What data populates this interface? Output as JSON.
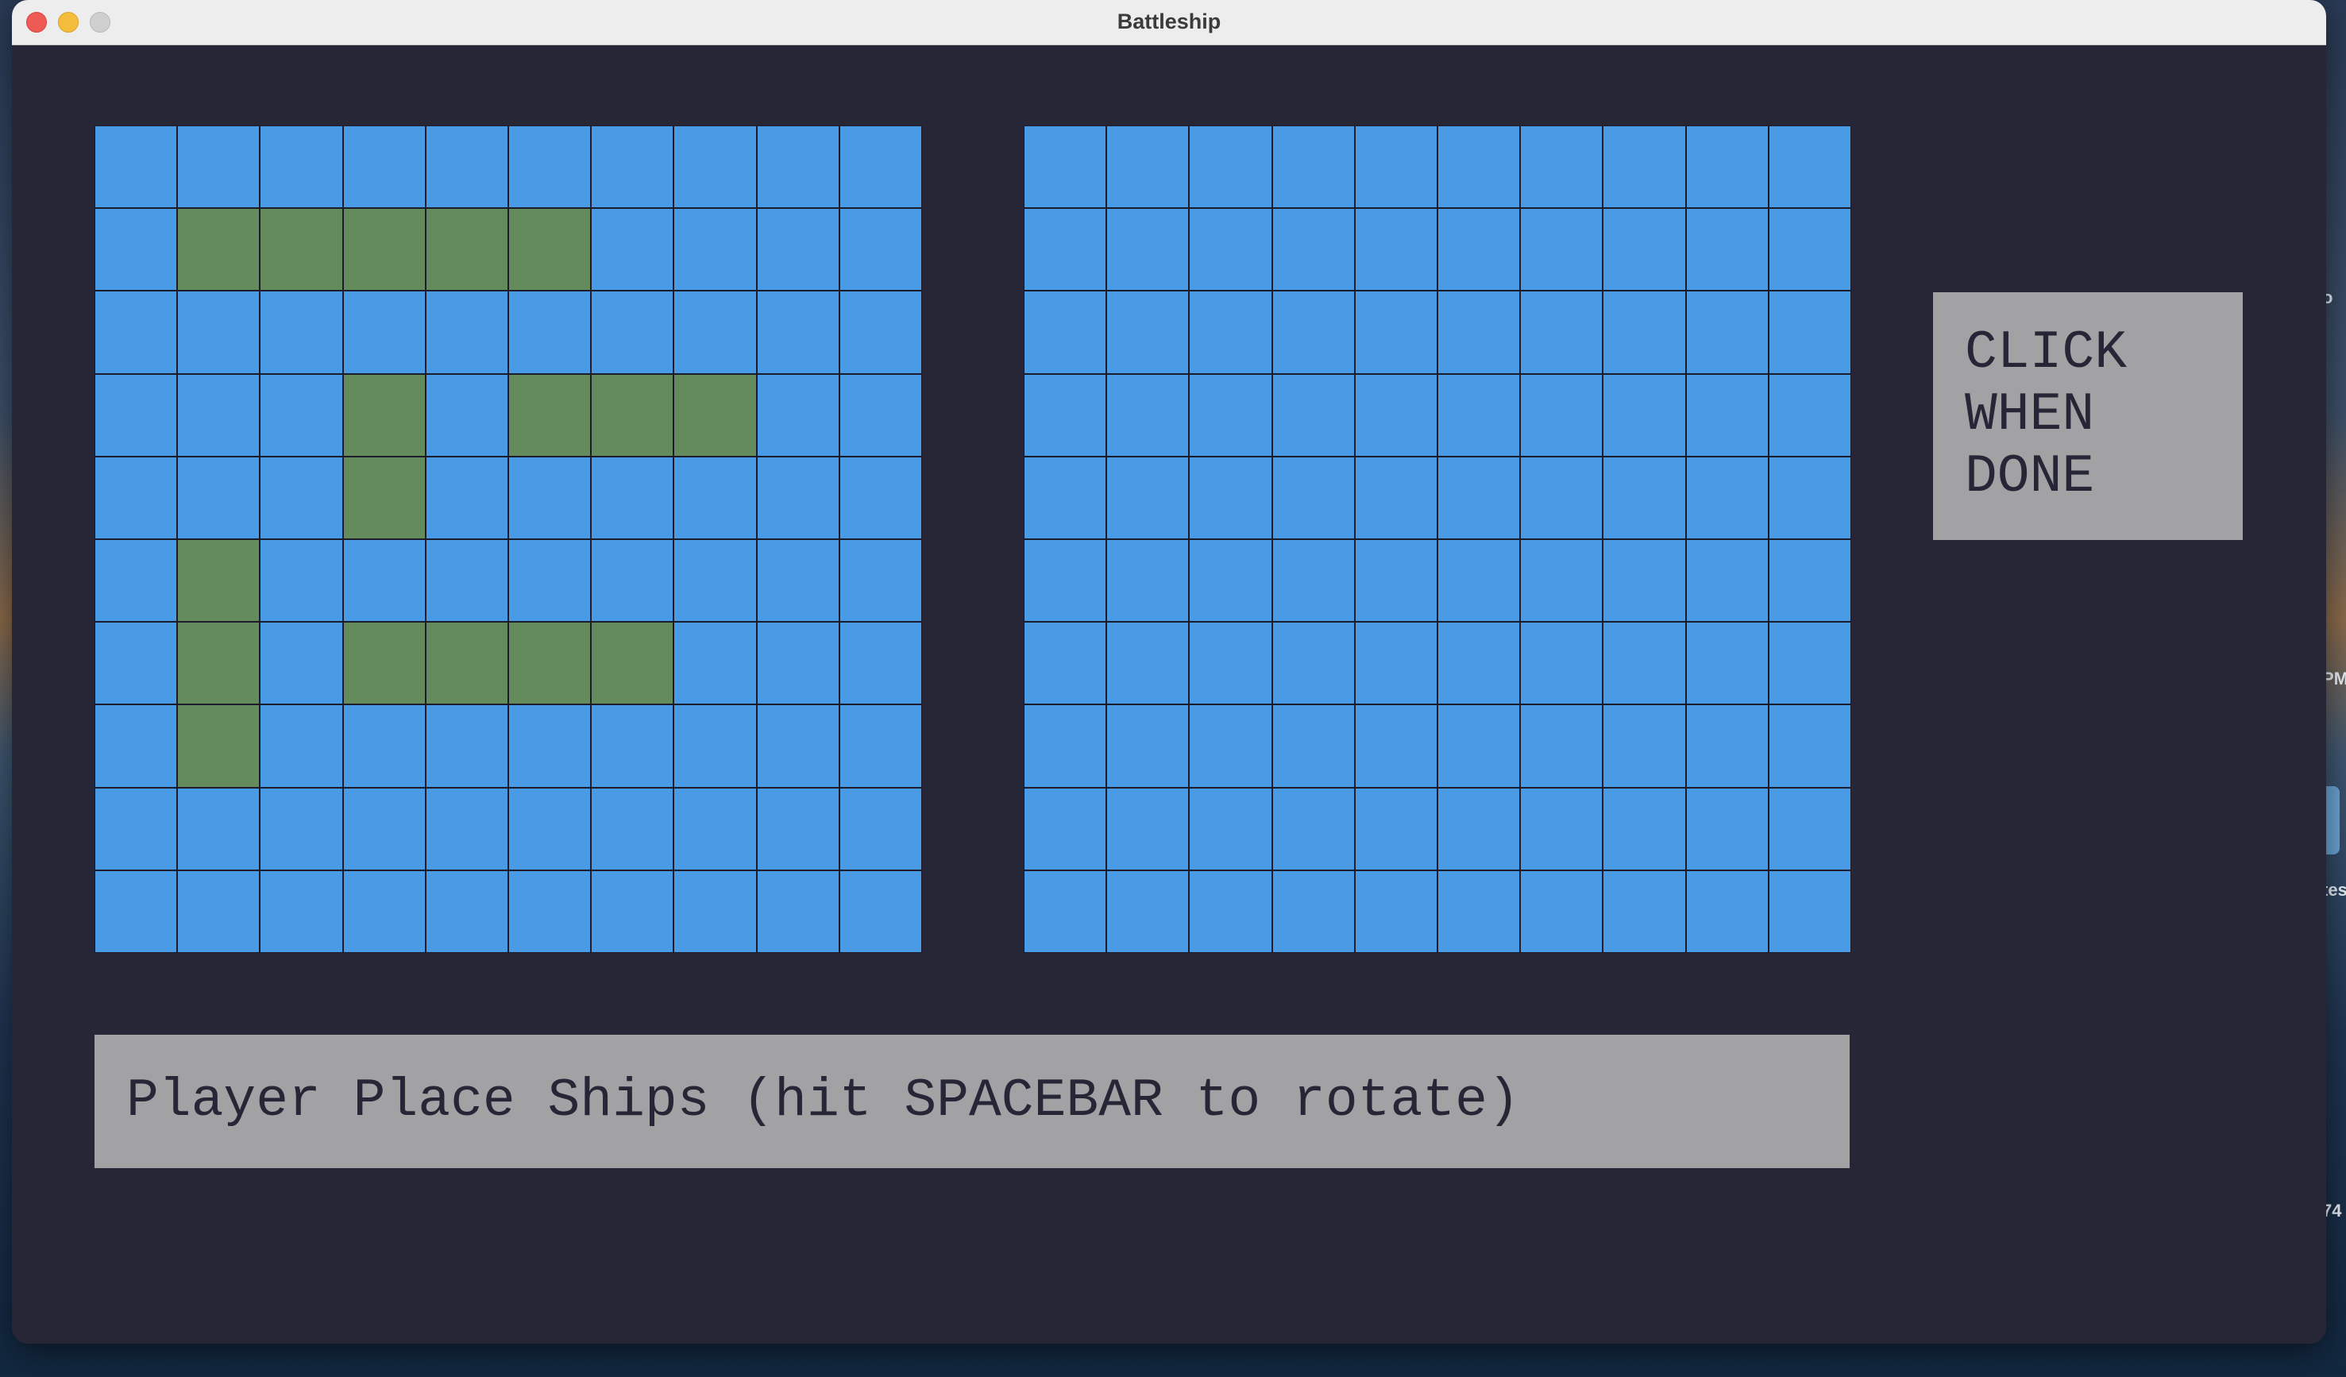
{
  "window": {
    "title": "Battleship"
  },
  "desktop_edge": [
    "o",
    "PM",
    "tes",
    "74"
  ],
  "player_board": {
    "rows": 10,
    "cols": 10,
    "ship_cells": [
      [
        1,
        1
      ],
      [
        1,
        2
      ],
      [
        1,
        3
      ],
      [
        1,
        4
      ],
      [
        1,
        5
      ],
      [
        3,
        3
      ],
      [
        4,
        3
      ],
      [
        3,
        5
      ],
      [
        3,
        6
      ],
      [
        3,
        7
      ],
      [
        5,
        1
      ],
      [
        6,
        1
      ],
      [
        7,
        1
      ],
      [
        6,
        3
      ],
      [
        6,
        4
      ],
      [
        6,
        5
      ],
      [
        6,
        6
      ]
    ]
  },
  "enemy_board": {
    "rows": 10,
    "cols": 10,
    "ship_cells": []
  },
  "done_button": {
    "lines": [
      "CLICK",
      "WHEN",
      "DONE"
    ]
  },
  "status": {
    "message": "Player Place Ships (hit SPACEBAR to rotate)"
  },
  "colors": {
    "water": "#489be4",
    "ship": "#648b5c",
    "background": "#262636",
    "panel": "#a2a2a5"
  }
}
